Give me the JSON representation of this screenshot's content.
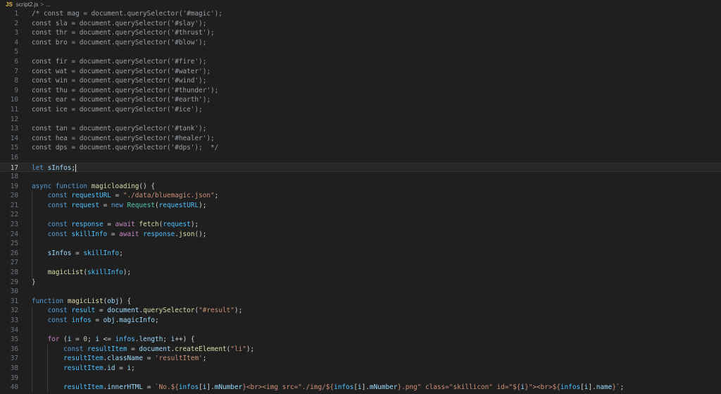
{
  "breadcrumb": {
    "file_icon": "JS",
    "file": "script2.js",
    "separator": ">",
    "more": "..."
  },
  "editor": {
    "active_line": 17,
    "lines": [
      {
        "n": "1",
        "tokens": [
          {
            "t": "/* const mag = document.querySelector('#magic');",
            "c": "cm"
          }
        ]
      },
      {
        "n": "2",
        "tokens": [
          {
            "t": "const sla = document.querySelector('#slay');",
            "c": "cm"
          }
        ]
      },
      {
        "n": "3",
        "tokens": [
          {
            "t": "const thr = document.querySelector('#thrust');",
            "c": "cm"
          }
        ]
      },
      {
        "n": "4",
        "tokens": [
          {
            "t": "const bro = document.querySelector('#blow');",
            "c": "cm"
          }
        ]
      },
      {
        "n": "5",
        "tokens": []
      },
      {
        "n": "6",
        "tokens": [
          {
            "t": "const fir = document.querySelector('#fire');",
            "c": "cm"
          }
        ]
      },
      {
        "n": "7",
        "tokens": [
          {
            "t": "const wat = document.querySelector('#water');",
            "c": "cm"
          }
        ]
      },
      {
        "n": "8",
        "tokens": [
          {
            "t": "const win = document.querySelector('#wind');",
            "c": "cm"
          }
        ]
      },
      {
        "n": "9",
        "tokens": [
          {
            "t": "const thu = document.querySelector('#thunder');",
            "c": "cm"
          }
        ]
      },
      {
        "n": "10",
        "tokens": [
          {
            "t": "const ear = document.querySelector('#earth');",
            "c": "cm"
          }
        ]
      },
      {
        "n": "11",
        "tokens": [
          {
            "t": "const ice = document.querySelector('#ice');",
            "c": "cm"
          }
        ]
      },
      {
        "n": "12",
        "tokens": []
      },
      {
        "n": "13",
        "tokens": [
          {
            "t": "const tan = document.querySelector('#tank');",
            "c": "cm"
          }
        ]
      },
      {
        "n": "14",
        "tokens": [
          {
            "t": "const hea = document.querySelector('#healer');",
            "c": "cm"
          }
        ]
      },
      {
        "n": "15",
        "tokens": [
          {
            "t": "const dps = document.querySelector('#dps');  */",
            "c": "cm"
          }
        ]
      },
      {
        "n": "16",
        "tokens": []
      },
      {
        "n": "17",
        "tokens": [
          {
            "t": "let ",
            "c": "kw"
          },
          {
            "t": "sInfos",
            "c": "var"
          },
          {
            "t": ";",
            "c": "p"
          }
        ]
      },
      {
        "n": "18",
        "tokens": []
      },
      {
        "n": "19",
        "tokens": [
          {
            "t": "async ",
            "c": "kw"
          },
          {
            "t": "function ",
            "c": "kw"
          },
          {
            "t": "magicloading",
            "c": "fn"
          },
          {
            "t": "() {",
            "c": "p"
          }
        ]
      },
      {
        "n": "20",
        "tokens": [
          {
            "t": "    const ",
            "c": "kw"
          },
          {
            "t": "requestURL",
            "c": "cst"
          },
          {
            "t": " = ",
            "c": "p"
          },
          {
            "t": "\"./data/bluemagic.json\"",
            "c": "str"
          },
          {
            "t": ";",
            "c": "p"
          }
        ]
      },
      {
        "n": "21",
        "tokens": [
          {
            "t": "    const ",
            "c": "kw"
          },
          {
            "t": "request",
            "c": "cst"
          },
          {
            "t": " = ",
            "c": "p"
          },
          {
            "t": "new ",
            "c": "kw"
          },
          {
            "t": "Request",
            "c": "cls"
          },
          {
            "t": "(",
            "c": "p"
          },
          {
            "t": "requestURL",
            "c": "cst"
          },
          {
            "t": ");",
            "c": "p"
          }
        ]
      },
      {
        "n": "22",
        "tokens": []
      },
      {
        "n": "23",
        "tokens": [
          {
            "t": "    const ",
            "c": "kw"
          },
          {
            "t": "response",
            "c": "cst"
          },
          {
            "t": " = ",
            "c": "p"
          },
          {
            "t": "await ",
            "c": "ct"
          },
          {
            "t": "fetch",
            "c": "fn"
          },
          {
            "t": "(",
            "c": "p"
          },
          {
            "t": "request",
            "c": "cst"
          },
          {
            "t": ");",
            "c": "p"
          }
        ]
      },
      {
        "n": "24",
        "tokens": [
          {
            "t": "    const ",
            "c": "kw"
          },
          {
            "t": "skillInfo",
            "c": "cst"
          },
          {
            "t": " = ",
            "c": "p"
          },
          {
            "t": "await ",
            "c": "ct"
          },
          {
            "t": "response",
            "c": "cst"
          },
          {
            "t": ".",
            "c": "p"
          },
          {
            "t": "json",
            "c": "fn"
          },
          {
            "t": "();",
            "c": "p"
          }
        ]
      },
      {
        "n": "25",
        "tokens": []
      },
      {
        "n": "26",
        "tokens": [
          {
            "t": "    sInfos",
            "c": "var"
          },
          {
            "t": " = ",
            "c": "p"
          },
          {
            "t": "skillInfo",
            "c": "cst"
          },
          {
            "t": ";",
            "c": "p"
          }
        ]
      },
      {
        "n": "27",
        "tokens": []
      },
      {
        "n": "28",
        "tokens": [
          {
            "t": "    magicList",
            "c": "fn"
          },
          {
            "t": "(",
            "c": "p"
          },
          {
            "t": "skillInfo",
            "c": "cst"
          },
          {
            "t": ");",
            "c": "p"
          }
        ]
      },
      {
        "n": "29",
        "tokens": [
          {
            "t": "}",
            "c": "p"
          }
        ]
      },
      {
        "n": "30",
        "tokens": []
      },
      {
        "n": "31",
        "tokens": [
          {
            "t": "function ",
            "c": "kw"
          },
          {
            "t": "magicList",
            "c": "fn"
          },
          {
            "t": "(",
            "c": "p"
          },
          {
            "t": "obj",
            "c": "var"
          },
          {
            "t": ") {",
            "c": "p"
          }
        ]
      },
      {
        "n": "32",
        "tokens": [
          {
            "t": "    const ",
            "c": "kw"
          },
          {
            "t": "result",
            "c": "cst"
          },
          {
            "t": " = ",
            "c": "p"
          },
          {
            "t": "document",
            "c": "var"
          },
          {
            "t": ".",
            "c": "p"
          },
          {
            "t": "querySelector",
            "c": "fn"
          },
          {
            "t": "(",
            "c": "p"
          },
          {
            "t": "\"#result\"",
            "c": "str"
          },
          {
            "t": ");",
            "c": "p"
          }
        ]
      },
      {
        "n": "33",
        "tokens": [
          {
            "t": "    const ",
            "c": "kw"
          },
          {
            "t": "infos",
            "c": "cst"
          },
          {
            "t": " = ",
            "c": "p"
          },
          {
            "t": "obj",
            "c": "var"
          },
          {
            "t": ".",
            "c": "p"
          },
          {
            "t": "magicInfo",
            "c": "var"
          },
          {
            "t": ";",
            "c": "p"
          }
        ]
      },
      {
        "n": "34",
        "tokens": []
      },
      {
        "n": "35",
        "tokens": [
          {
            "t": "    for ",
            "c": "ct"
          },
          {
            "t": "(",
            "c": "p"
          },
          {
            "t": "i",
            "c": "var"
          },
          {
            "t": " = ",
            "c": "p"
          },
          {
            "t": "0",
            "c": "num"
          },
          {
            "t": "; ",
            "c": "p"
          },
          {
            "t": "i",
            "c": "var"
          },
          {
            "t": " <= ",
            "c": "p"
          },
          {
            "t": "infos",
            "c": "cst"
          },
          {
            "t": ".",
            "c": "p"
          },
          {
            "t": "length",
            "c": "var"
          },
          {
            "t": "; ",
            "c": "p"
          },
          {
            "t": "i",
            "c": "var"
          },
          {
            "t": "++) {",
            "c": "p"
          }
        ]
      },
      {
        "n": "36",
        "tokens": [
          {
            "t": "        const ",
            "c": "kw"
          },
          {
            "t": "resultItem",
            "c": "cst"
          },
          {
            "t": " = ",
            "c": "p"
          },
          {
            "t": "document",
            "c": "var"
          },
          {
            "t": ".",
            "c": "p"
          },
          {
            "t": "createElement",
            "c": "fn"
          },
          {
            "t": "(",
            "c": "p"
          },
          {
            "t": "\"li\"",
            "c": "str"
          },
          {
            "t": ");",
            "c": "p"
          }
        ]
      },
      {
        "n": "37",
        "tokens": [
          {
            "t": "        resultItem",
            "c": "cst"
          },
          {
            "t": ".",
            "c": "p"
          },
          {
            "t": "className",
            "c": "var"
          },
          {
            "t": " = ",
            "c": "p"
          },
          {
            "t": "'resultItem'",
            "c": "str"
          },
          {
            "t": ";",
            "c": "p"
          }
        ]
      },
      {
        "n": "38",
        "tokens": [
          {
            "t": "        resultItem",
            "c": "cst"
          },
          {
            "t": ".",
            "c": "p"
          },
          {
            "t": "id",
            "c": "var"
          },
          {
            "t": " = ",
            "c": "p"
          },
          {
            "t": "i",
            "c": "var"
          },
          {
            "t": ";",
            "c": "p"
          }
        ]
      },
      {
        "n": "39",
        "tokens": []
      },
      {
        "n": "40",
        "tokens": [
          {
            "t": "        resultItem",
            "c": "cst"
          },
          {
            "t": ".",
            "c": "p"
          },
          {
            "t": "innerHTML",
            "c": "var"
          },
          {
            "t": " = ",
            "c": "p"
          },
          {
            "t": "`No.${",
            "c": "str"
          },
          {
            "t": "infos",
            "c": "cst"
          },
          {
            "t": "[",
            "c": "p"
          },
          {
            "t": "i",
            "c": "var"
          },
          {
            "t": "].",
            "c": "p"
          },
          {
            "t": "mNumber",
            "c": "var"
          },
          {
            "t": "}<br><img src=\"./img/${",
            "c": "str"
          },
          {
            "t": "infos",
            "c": "cst"
          },
          {
            "t": "[",
            "c": "p"
          },
          {
            "t": "i",
            "c": "var"
          },
          {
            "t": "].",
            "c": "p"
          },
          {
            "t": "mNumber",
            "c": "var"
          },
          {
            "t": "}.png\" class=\"skillicon\" id=\"${",
            "c": "str"
          },
          {
            "t": "i",
            "c": "var"
          },
          {
            "t": "}\"><br>${",
            "c": "str"
          },
          {
            "t": "infos",
            "c": "cst"
          },
          {
            "t": "[",
            "c": "p"
          },
          {
            "t": "i",
            "c": "var"
          },
          {
            "t": "].",
            "c": "p"
          },
          {
            "t": "name",
            "c": "var"
          },
          {
            "t": "}`",
            "c": "str"
          },
          {
            "t": ";",
            "c": "p"
          }
        ]
      }
    ]
  }
}
